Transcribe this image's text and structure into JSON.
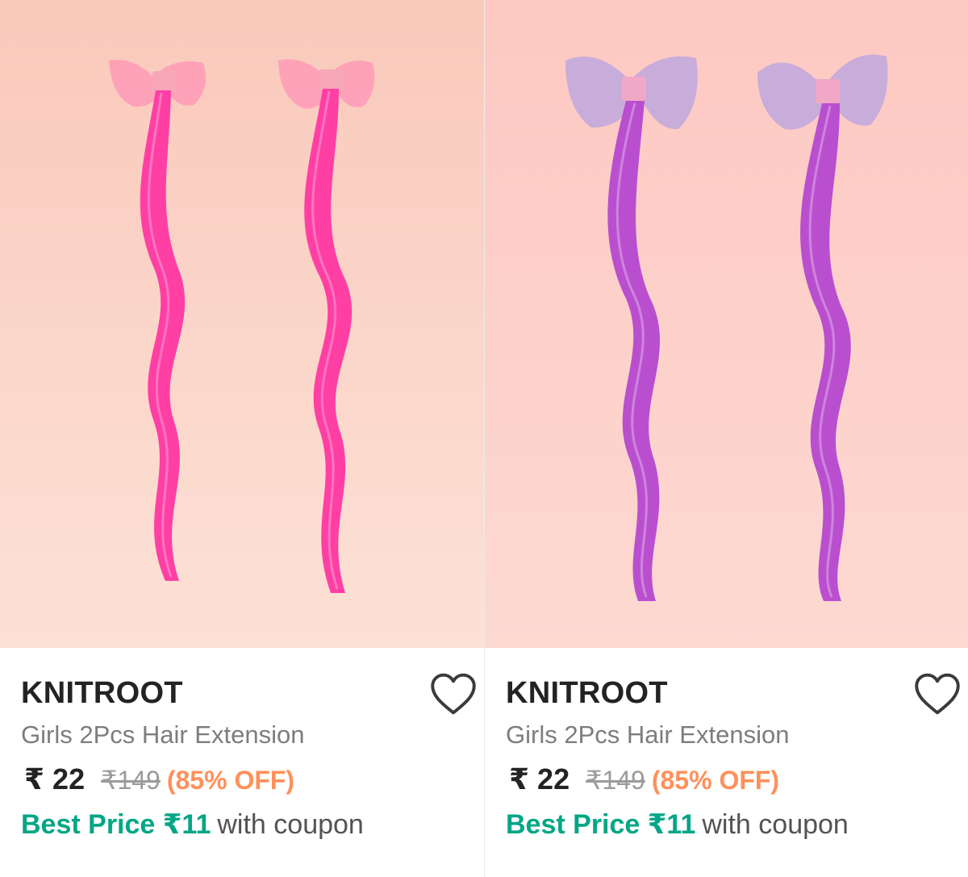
{
  "products": [
    {
      "image_alt": "pink hair extensions with bows",
      "hair_color": "#ff3fa4",
      "bow_color": "#ff8fb0",
      "background_color": "#fcd0c2",
      "wishlist_icon": "heart-outline-icon",
      "brand": "KNITROOT",
      "title": "Girls 2Pcs Hair Extension",
      "price": "₹ 22",
      "mrp": "₹149",
      "discount": "(85% OFF)",
      "best_price_label": "Best Price ₹11",
      "best_price_suffix": "with coupon"
    },
    {
      "image_alt": "purple hair extensions with bows",
      "hair_color": "#b94fcf",
      "bow_color": "#c2a8dc",
      "background_color": "#fdcdc6",
      "wishlist_icon": "heart-outline-icon",
      "brand": "KNITROOT",
      "title": "Girls 2Pcs Hair Extension",
      "price": "₹ 22",
      "mrp": "₹149",
      "discount": "(85% OFF)",
      "best_price_label": "Best Price ₹11",
      "best_price_suffix": "with coupon"
    }
  ],
  "colors": {
    "brand_text": "#232323",
    "discount": "#ff905a",
    "best_price": "#03a685"
  }
}
